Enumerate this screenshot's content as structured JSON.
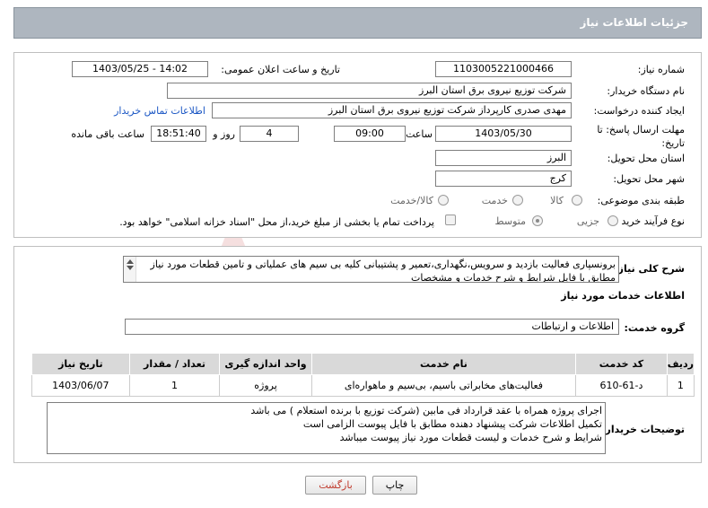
{
  "title": "جزئیات اطلاعات نیاز",
  "form": {
    "need_number_label": "شماره نیاز:",
    "need_number": "1103005221000466",
    "announce_label": "تاریخ و ساعت اعلان عمومی:",
    "announce_value": "1403/05/25 - 14:02",
    "buyer_label": "نام دستگاه خریدار:",
    "buyer_value": "شرکت توزیع نیروی برق استان البرز",
    "creator_label": "ایجاد کننده درخواست:",
    "creator_value": "مهدی صدری کارپرداز شرکت توزیع نیروی برق استان البرز",
    "contact_link": "اطلاعات تماس خریدار",
    "deadline_label": "مهلت ارسال پاسخ: تا تاریخ:",
    "deadline_date": "1403/05/30",
    "time_label": "ساعت",
    "deadline_time": "09:00",
    "days_value": "4",
    "days_label": "روز و",
    "remaining_time": "18:51:40",
    "remaining_label": "ساعت باقی مانده",
    "province_label": "استان محل تحویل:",
    "province_value": "البرز",
    "city_label": "شهر محل تحویل:",
    "city_value": "کرج",
    "category_label": "طبقه بندی موضوعی:",
    "category_options": [
      "کالا",
      "خدمت",
      "کالا/خدمت"
    ],
    "process_label": "نوع فرآیند خرید :",
    "process_options": [
      "جزیی",
      "متوسط"
    ],
    "payment_note": "پرداخت تمام یا بخشی از مبلغ خرید،از محل \"اسناد خزانه اسلامی\" خواهد بود."
  },
  "summary": {
    "label": "شرح کلی نیاز:",
    "text": "برونسپاری فعالیت بازدید و سرویس،نگهداری،تعمیر و پشتیبانی کلیه بی سیم های عملیاتی و تامین قطعات مورد نیاز مطابق با فایل شرایط و شرح خدمات و مشخصات"
  },
  "services": {
    "heading": "اطلاعات خدمات مورد نیاز",
    "group_label": "گروه خدمت:",
    "group_value": "اطلاعات و ارتباطات",
    "columns": [
      "ردیف",
      "کد خدمت",
      "نام خدمت",
      "واحد اندازه گیری",
      "تعداد / مقدار",
      "تاریخ نیاز"
    ],
    "rows": [
      [
        "1",
        "د-61-610",
        "فعالیت‌های مخابراتی باسیم، بی‌سیم و ماهواره‌ای",
        "پروژه",
        "1",
        "1403/06/07"
      ]
    ]
  },
  "buyer_notes": {
    "label": "توضیحات خریدار:",
    "lines": [
      "اجرای پروژه همراه با عقد قرارداد فی مابین (شرکت توزیع با برنده استعلام ) می باشد",
      "تکمیل اطلاعات شرکت پیشنهاد دهنده مطابق با فایل پیوست الزامی است",
      "شرایط و شرح خدمات و لیست قطعات مورد نیاز پیوست میباشد"
    ]
  },
  "buttons": {
    "print": "چاپ",
    "back": "بازگشت"
  },
  "colors": {
    "title_bg": "#aeb6bf",
    "link": "#1a56c4",
    "back_text": "#c0392b"
  }
}
